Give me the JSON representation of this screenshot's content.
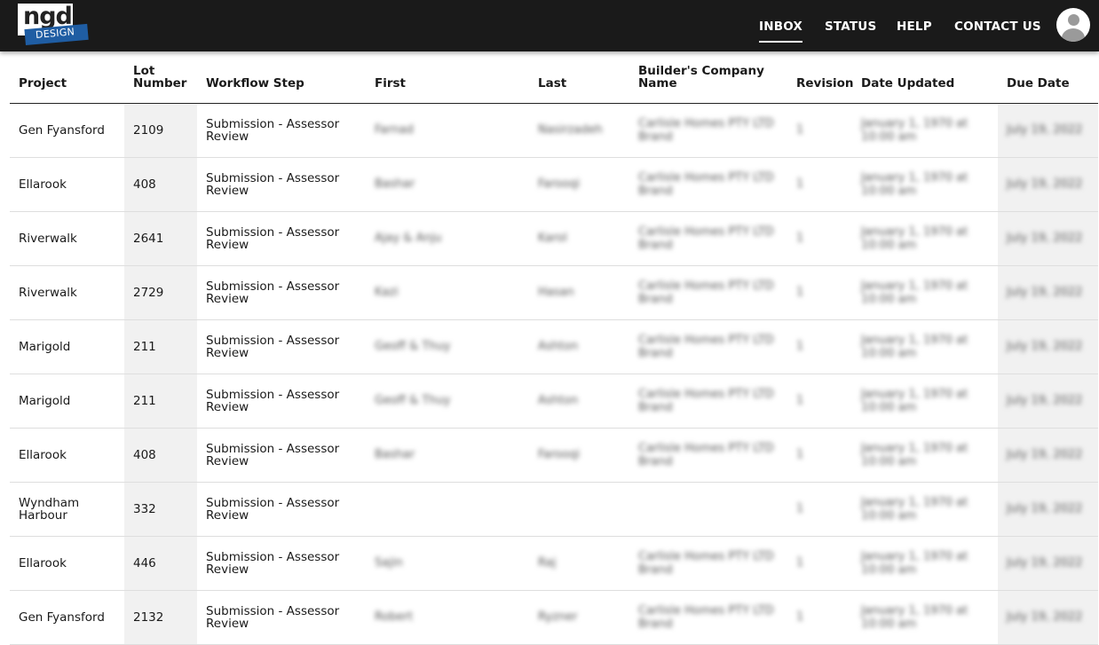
{
  "logo": {
    "top_text": "ngd",
    "band_text": "DESIGN"
  },
  "nav": [
    {
      "label": "INBOX",
      "active": true
    },
    {
      "label": "STATUS",
      "active": false
    },
    {
      "label": "HELP",
      "active": false
    },
    {
      "label": "CONTACT US",
      "active": false
    }
  ],
  "columns": [
    "Project",
    "Lot Number",
    "Workflow Step",
    "First",
    "Last",
    "Builder's Company Name",
    "Revision",
    "Date Updated",
    "Due Date"
  ],
  "rows": [
    {
      "project": "Gen Fyansford",
      "lot": "2109",
      "step": "Submission - Assessor Review",
      "first": "Farnad",
      "last": "Nasirzadeh",
      "company": "Carlisle Homes PTY LTD Brand",
      "revision": "1",
      "updated": "January 1, 1970 at 10:00 am",
      "due": "July 19, 2022"
    },
    {
      "project": "Ellarook",
      "lot": "408",
      "step": "Submission - Assessor Review",
      "first": "Bashar",
      "last": "Farooqi",
      "company": "Carlisle Homes PTY LTD Brand",
      "revision": "1",
      "updated": "January 1, 1970 at 10:00 am",
      "due": "July 19, 2022"
    },
    {
      "project": "Riverwalk",
      "lot": "2641",
      "step": "Submission - Assessor Review",
      "first": "Ajay & Anju",
      "last": "Karol",
      "company": "Carlisle Homes PTY LTD Brand",
      "revision": "1",
      "updated": "January 1, 1970 at 10:00 am",
      "due": "July 19, 2022"
    },
    {
      "project": "Riverwalk",
      "lot": "2729",
      "step": "Submission - Assessor Review",
      "first": "Kazi",
      "last": "Hasan",
      "company": "Carlisle Homes PTY LTD Brand",
      "revision": "1",
      "updated": "January 1, 1970 at 10:00 am",
      "due": "July 19, 2022"
    },
    {
      "project": "Marigold",
      "lot": "211",
      "step": "Submission - Assessor Review",
      "first": "Geoff & Thuy",
      "last": "Ashton",
      "company": "Carlisle Homes PTY LTD Brand",
      "revision": "1",
      "updated": "January 1, 1970 at 10:00 am",
      "due": "July 19, 2022"
    },
    {
      "project": "Marigold",
      "lot": "211",
      "step": "Submission - Assessor Review",
      "first": "Geoff & Thuy",
      "last": "Ashton",
      "company": "Carlisle Homes PTY LTD Brand",
      "revision": "1",
      "updated": "January 1, 1970 at 10:00 am",
      "due": "July 19, 2022"
    },
    {
      "project": "Ellarook",
      "lot": "408",
      "step": "Submission - Assessor Review",
      "first": "Bashar",
      "last": "Farooqi",
      "company": "Carlisle Homes PTY LTD Brand",
      "revision": "1",
      "updated": "January 1, 1970 at 10:00 am",
      "due": "July 19, 2022"
    },
    {
      "project": "Wyndham Harbour",
      "lot": "332",
      "step": "Submission - Assessor Review",
      "first": "",
      "last": "",
      "company": "",
      "revision": "1",
      "updated": "January 1, 1970 at 10:00 am",
      "due": "July 19, 2022"
    },
    {
      "project": "Ellarook",
      "lot": "446",
      "step": "Submission - Assessor Review",
      "first": "Sajin",
      "last": "Raj",
      "company": "Carlisle Homes PTY LTD Brand",
      "revision": "1",
      "updated": "January 1, 1970 at 10:00 am",
      "due": "July 19, 2022"
    },
    {
      "project": "Gen Fyansford",
      "lot": "2132",
      "step": "Submission - Assessor Review",
      "first": "Robert",
      "last": "Ryzner",
      "company": "Carlisle Homes PTY LTD Brand",
      "revision": "1",
      "updated": "January 1, 1970 at 10:00 am",
      "due": "July 19, 2022"
    }
  ]
}
